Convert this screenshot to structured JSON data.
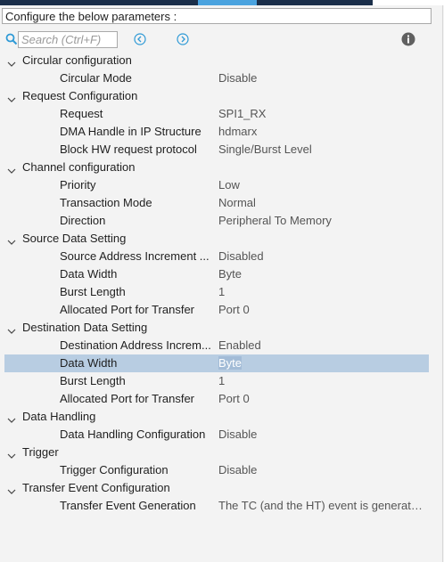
{
  "header": {
    "title": "Configure the below parameters :"
  },
  "search": {
    "placeholder": "Search (Ctrl+F)"
  },
  "colors": {
    "accent": "#2f9ad6",
    "selection": "#b8cde2",
    "tab_blue": "#4aa3df",
    "tab_dark": "#1b2f4a"
  },
  "icons": {
    "search": "search-icon",
    "prev": "chevron-left-circle-icon",
    "next": "chevron-right-circle-icon",
    "info": "info-icon",
    "collapse": "chevron-down-icon"
  },
  "groups": [
    {
      "label": "Circular configuration",
      "params": [
        {
          "name": "Circular Mode",
          "value": "Disable"
        }
      ]
    },
    {
      "label": "Request Configuration",
      "params": [
        {
          "name": "Request",
          "value": "SPI1_RX"
        },
        {
          "name": "DMA Handle in IP Structure",
          "value": "hdmarx"
        },
        {
          "name": "Block HW request protocol",
          "value": "Single/Burst Level"
        }
      ]
    },
    {
      "label": "Channel configuration",
      "params": [
        {
          "name": "Priority",
          "value": "Low"
        },
        {
          "name": "Transaction Mode",
          "value": "Normal"
        },
        {
          "name": "Direction",
          "value": "Peripheral To Memory"
        }
      ]
    },
    {
      "label": "Source Data Setting",
      "params": [
        {
          "name": "Source Address Increment ...",
          "value": "Disabled"
        },
        {
          "name": "Data Width",
          "value": "Byte"
        },
        {
          "name": "Burst Length",
          "value": "1"
        },
        {
          "name": "Allocated Port for Transfer",
          "value": "Port 0"
        }
      ]
    },
    {
      "label": "Destination Data Setting",
      "params": [
        {
          "name": "Destination Address Increm...",
          "value": "Enabled"
        },
        {
          "name": "Data Width",
          "value": "Byte"
        },
        {
          "name": "Burst Length",
          "value": "1"
        },
        {
          "name": "Allocated Port for Transfer",
          "value": "Port 0"
        }
      ]
    },
    {
      "label": "Data Handling",
      "params": [
        {
          "name": "Data Handling Configuration",
          "value": "Disable"
        }
      ]
    },
    {
      "label": "Trigger",
      "params": [
        {
          "name": "Trigger Configuration",
          "value": "Disable"
        }
      ]
    },
    {
      "label": "Transfer Event Configuration",
      "params": [
        {
          "name": "Transfer Event Generation",
          "value": "The TC (and the HT) event is generate..."
        }
      ]
    }
  ]
}
